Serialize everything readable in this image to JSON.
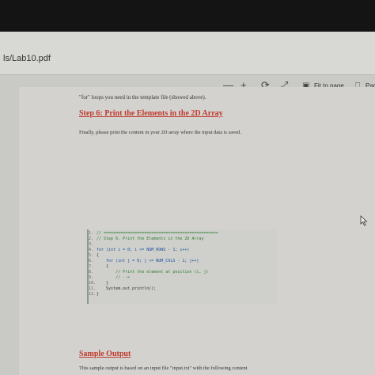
{
  "window": {
    "file_title": "ls/Lab10.pdf"
  },
  "toolbar": {
    "zoom_out": "—",
    "zoom_in": "+",
    "rotate": "⟳",
    "fit_label": "Fit to page",
    "page_label": "Pag"
  },
  "doc": {
    "intro_line": "\"for\" loops you need in the template file (showed above).",
    "step6_heading": "Step 6: Print the Elements in the 2D Array",
    "step6_body": "Finally, please print the content in your 2D array where the input data is saved.",
    "code_lines": [
      {
        "num": "1.",
        "text": "// ================================================"
      },
      {
        "num": "2.",
        "text": "// Step 6. Print the Elements in the 2D Array"
      },
      {
        "num": "3.",
        "text": ""
      },
      {
        "num": "4.",
        "text": "for (int i = 0; i <= NUM_ROWS - 1; i++)"
      },
      {
        "num": "5.",
        "text": "{"
      },
      {
        "num": "6.",
        "text": "    for (int j = 0; j <= NUM_COLS - 1; j++)"
      },
      {
        "num": "7.",
        "text": "    {"
      },
      {
        "num": "8.",
        "text": "        // Print the element at position (i, j)"
      },
      {
        "num": "9.",
        "text": "        // -->"
      },
      {
        "num": "10.",
        "text": "    }"
      },
      {
        "num": "11.",
        "text": "    System.out.println();"
      },
      {
        "num": "12.",
        "text": "}"
      }
    ],
    "sample_heading": "Sample Output",
    "sample_body": "This sample output is based on an input file \"input.txt\" with the following content"
  }
}
